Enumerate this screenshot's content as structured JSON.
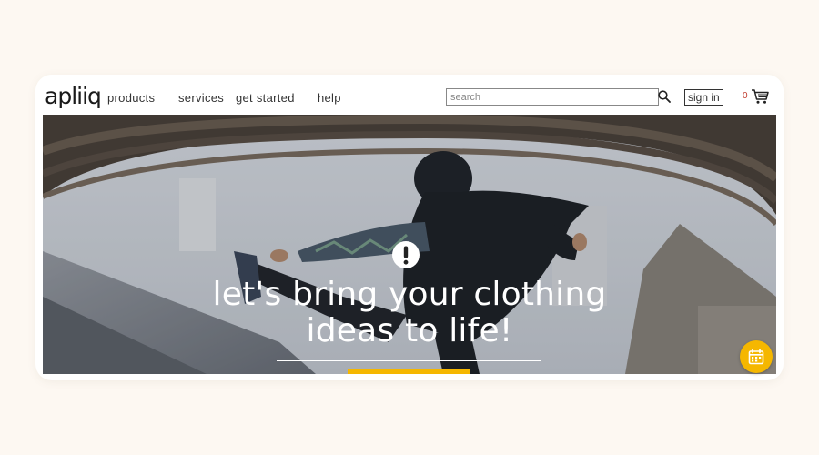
{
  "brand": {
    "logo_text": "apliiq"
  },
  "nav": {
    "items": [
      {
        "label": "products"
      },
      {
        "label": "services"
      },
      {
        "label": "get started"
      },
      {
        "label": "help"
      }
    ],
    "search": {
      "placeholder": "search",
      "value": ""
    },
    "sign_in_label": "sign in",
    "cart_count": "0",
    "icons": {
      "search": "search-icon",
      "cart": "cart-icon"
    }
  },
  "hero": {
    "headline_line1": "let's bring your clothing",
    "headline_line2": "ideas to life!",
    "notice_icon": "exclamation-icon"
  },
  "fab": {
    "icon": "calendar-icon"
  },
  "colors": {
    "accent": "#f5b700",
    "cart_count": "#c0392b",
    "page_bg": "#fdf8f2"
  }
}
